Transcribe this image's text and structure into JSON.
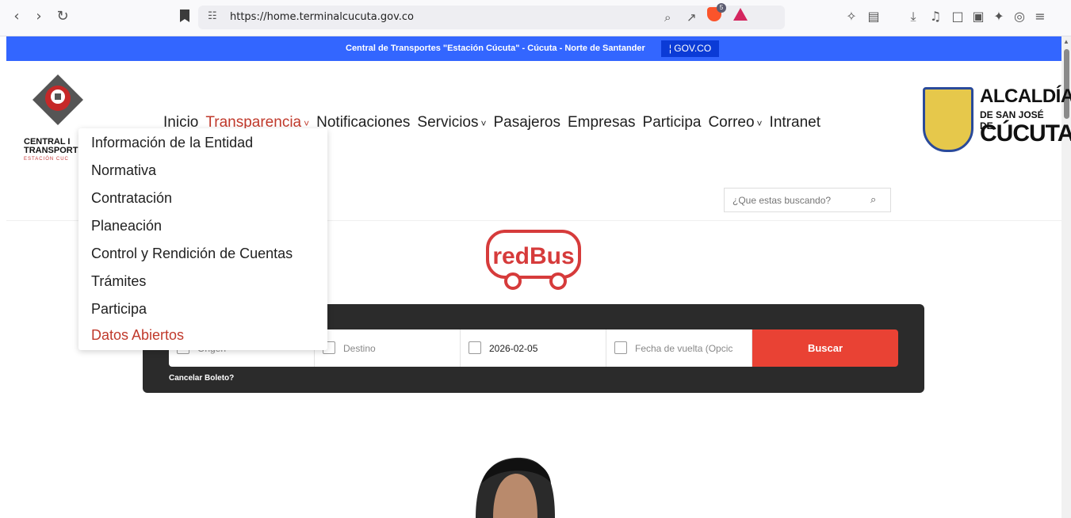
{
  "browser": {
    "url": "https://home.terminalcucuta.gov.co",
    "brave_badge": "5"
  },
  "govbar": {
    "text": "Central de Transportes \"Estación Cúcuta\" - Cúcuta - Norte de Santander",
    "gov_label": "¦ GOV.CO"
  },
  "site": {
    "logo_left_line1": "CENTRAL I",
    "logo_left_line2": "TRANSPORT",
    "logo_left_sub": "ESTACIÓN CUC",
    "logo_right_1": "ALCALDÍA",
    "logo_right_2": "DE SAN JOSÉ DE",
    "logo_right_3": "CÚCUTA"
  },
  "nav": {
    "items": [
      {
        "label": "Inicio",
        "caret": false,
        "active": false
      },
      {
        "label": "Transparencia",
        "caret": true,
        "active": true
      },
      {
        "label": "Notificaciones",
        "caret": false,
        "active": false
      },
      {
        "label": "Servicios",
        "caret": true,
        "active": false
      },
      {
        "label": "Pasajeros",
        "caret": false,
        "active": false
      },
      {
        "label": "Empresas",
        "caret": false,
        "active": false
      },
      {
        "label": "Participa",
        "caret": false,
        "active": false
      },
      {
        "label": "Correo",
        "caret": true,
        "active": false
      },
      {
        "label": "Intranet",
        "caret": false,
        "active": false
      }
    ]
  },
  "search": {
    "placeholder": "¿Que estas buscando?"
  },
  "dropdown": {
    "items": [
      {
        "label": "Información de la Entidad"
      },
      {
        "label": "Normativa"
      },
      {
        "label": "Contratación"
      },
      {
        "label": "Planeación"
      },
      {
        "label": "Control y Rendición de Cuentas"
      },
      {
        "label": "Trámites"
      },
      {
        "label": "Participa"
      },
      {
        "label": "Datos Abiertos"
      }
    ]
  },
  "redbus": {
    "logo_text": "redBus",
    "origin_placeholder": "Origen",
    "destination_placeholder": "Destino",
    "date_value": "2026-02-05",
    "return_placeholder": "Fecha de vuelta (Opcic",
    "search_label": "Buscar",
    "cancel_label": "Cancelar Boleto?"
  },
  "colors": {
    "gov_blue": "#3366ff",
    "accent_red": "#c0392b",
    "buscar_red": "#e94234"
  }
}
